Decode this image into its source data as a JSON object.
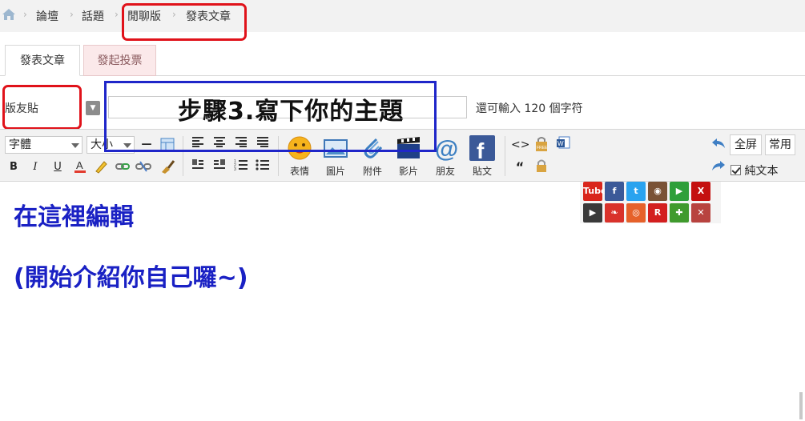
{
  "breadcrumb": {
    "items": [
      "論壇",
      "話題",
      "閒聊版",
      "發表文章"
    ],
    "separator": "›"
  },
  "tabs": [
    {
      "label": "發表文章",
      "active": true
    },
    {
      "label": "發起投票",
      "active": false
    }
  ],
  "post_type": {
    "value": "版友貼"
  },
  "subject": {
    "value": "",
    "remaining_text": "還可輸入 120 個字符"
  },
  "annotation": {
    "step_text": "步驟3.寫下你的主題"
  },
  "toolbar": {
    "font_select": "字體",
    "size_select": "大小",
    "format_buttons": [
      "B",
      "I",
      "U"
    ],
    "insert_buttons": [
      {
        "label": "表情",
        "icon": "smiley-icon"
      },
      {
        "label": "圖片",
        "icon": "image-icon"
      },
      {
        "label": "附件",
        "icon": "paperclip-icon"
      },
      {
        "label": "影片",
        "icon": "film-icon"
      },
      {
        "label": "朋友",
        "icon": "at-sign-icon"
      },
      {
        "label": "貼文",
        "icon": "facebook-icon"
      }
    ],
    "fullscreen": "全屏",
    "common": "常用",
    "plain_text": "純文本"
  },
  "share_icons": [
    {
      "name": "youtube-icon",
      "text": "Tube",
      "color": "#d9261c"
    },
    {
      "name": "facebook-share-icon",
      "text": "f",
      "color": "#3b5998"
    },
    {
      "name": "twitter-icon",
      "text": "t",
      "color": "#2aa3ef"
    },
    {
      "name": "instagram-icon",
      "text": "◉",
      "color": "#7a5235"
    },
    {
      "name": "play-icon",
      "text": "▶",
      "color": "#2e9f3a"
    },
    {
      "name": "close-x-icon",
      "text": "X",
      "color": "#c4100f"
    },
    {
      "name": "video-play-icon",
      "text": "▶",
      "color": "#3a3a3a"
    },
    {
      "name": "logo-icon",
      "text": "❧",
      "color": "#d9322b"
    },
    {
      "name": "weibo-icon",
      "text": "◎",
      "color": "#e6612a"
    },
    {
      "name": "r-icon",
      "text": "R",
      "color": "#d31f1f"
    },
    {
      "name": "puzzle-icon",
      "text": "✚",
      "color": "#3f9a2d"
    },
    {
      "name": "x-box-icon",
      "text": "✕",
      "color": "#b8433f"
    }
  ],
  "content": {
    "line1": "在這裡編輯",
    "line2": "(開始介紹你自己囉~)"
  },
  "colors": {
    "annotation_red": "#e0121a",
    "annotation_blue": "#1f26c9",
    "content_text": "#1a21c4"
  }
}
